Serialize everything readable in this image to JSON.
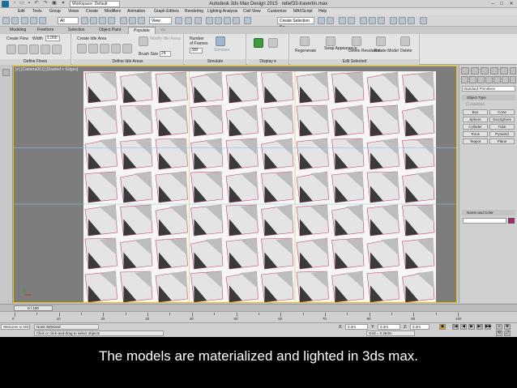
{
  "window": {
    "app_title": "Autodesk 3ds Max Design 2015",
    "file_name": "relief33-travertin.max",
    "workspace": "Workspace: Default",
    "controls": [
      "–",
      "□",
      "✕"
    ]
  },
  "menu": [
    "Edit",
    "Tools",
    "Group",
    "Views",
    "Create",
    "Modifiers",
    "Animation",
    "Graph Editors",
    "Rendering",
    "Lighting Analysis",
    "Civil View",
    "Customize",
    "MAXScript",
    "Help"
  ],
  "toolbar": {
    "selection_filter": "All",
    "reference_coord": "View",
    "named_selection": "Create Selection Se"
  },
  "ribbon_tabs": [
    "Modeling",
    "Freeform",
    "Selection",
    "Object Paint",
    "Populate"
  ],
  "active_ribbon_tab": "Populate",
  "ribbon": {
    "define_flows": {
      "label": "Define Flows",
      "create_flow": "Create Flow",
      "width_label": "Width",
      "width_value": "1.000"
    },
    "define_idle_areas": {
      "label": "Define Idle Areas",
      "create_idle_area": "Create Idle Area",
      "modify_idle_areas": "Modify Idle Areas",
      "brush_size_label": "Brush Size",
      "brush_size_value": "24"
    },
    "simulate": {
      "label": "Simulate",
      "number_of_frames_line1": "Number",
      "number_of_frames_line2": "of Frames",
      "frames_value": "300",
      "simulate_button": "Simulate"
    },
    "display": {
      "label": "Display"
    },
    "edit_selected": {
      "label": "Edit Selected",
      "regenerate": "Regenerate",
      "swap_appearance": "Swap Appearance",
      "delete_resolution": "Delete Resolution",
      "rotate_model": "Rotate Model",
      "delete": "Delete"
    }
  },
  "viewport": {
    "label": "[+] [Camera001] [Shaded + Edges]",
    "background": "#7d7d7d",
    "panel_fill": "#e4e4e4",
    "edge_color": "#c04070",
    "shadow_color": "#3a3a3a"
  },
  "command_panel": {
    "category": "Standard Primitives",
    "object_type_title": "Object Type",
    "autogrid": "AutoGrid",
    "buttons": [
      "Box",
      "Cone",
      "Sphere",
      "GeoSphere",
      "Cylinder",
      "Tube",
      "Torus",
      "Pyramid",
      "Teapot",
      "Plane"
    ],
    "name_and_color_title": "Name and Color",
    "color": "#b0206c"
  },
  "timeline": {
    "slider_label": "0 / 100",
    "ticks": [
      "0",
      "5",
      "10",
      "15",
      "20",
      "25",
      "30",
      "35",
      "40",
      "45",
      "50",
      "55",
      "60",
      "65",
      "70",
      "75",
      "80",
      "85",
      "90",
      "95",
      "100"
    ]
  },
  "status": {
    "welcome": "Welcome to MS",
    "selection": "None Selected",
    "prompt": "Click or click-and-drag to select objects",
    "x_label": "X:",
    "x_value": "0.0m",
    "y_label": "Y:",
    "y_value": "0.0m",
    "z_label": "Z:",
    "z_value": "0.0m",
    "grid": "Grid = 0.254m"
  },
  "caption": "The models are materialized and lighted in 3ds max."
}
